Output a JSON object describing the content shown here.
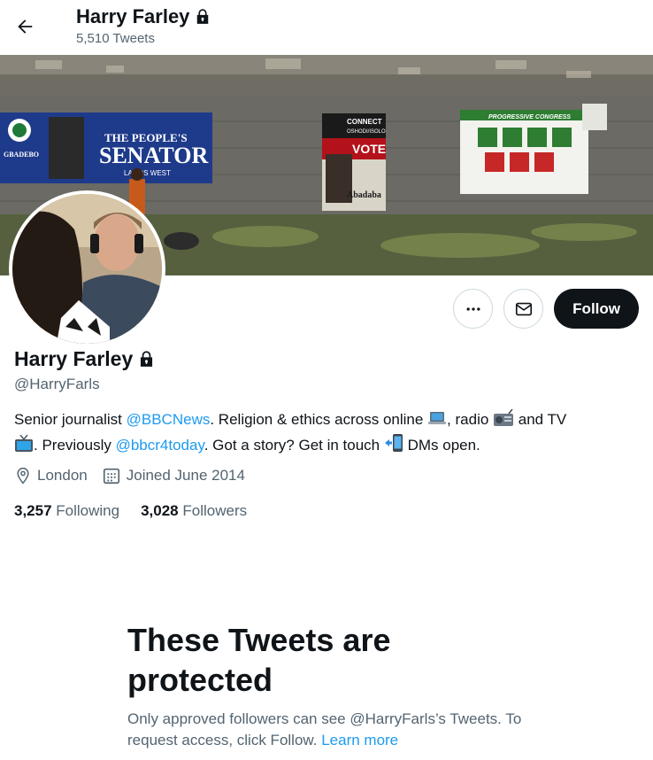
{
  "header": {
    "title": "Harry Farley",
    "tweet_count": "5,510 Tweets"
  },
  "profile": {
    "name": "Harry Farley",
    "handle": "@HarryFarls",
    "bio": {
      "part1": "Senior journalist ",
      "mention1": "@BBCNews",
      "part2": ". Religion & ethics across online ",
      "part3": ", radio ",
      "part4": " and TV",
      "part5": ". Previously ",
      "mention2": "@bbcr4today",
      "part6": ". Got a story? Get in touch ",
      "part7": " DMs open."
    },
    "location": "London",
    "joined": "Joined June 2014",
    "following_count": "3,257",
    "following_label": "Following",
    "followers_count": "3,028",
    "followers_label": "Followers"
  },
  "actions": {
    "follow_label": "Follow"
  },
  "banner": {
    "poster_left_line1": "THE PEOPLE'S",
    "poster_left_line2": "SENATOR",
    "poster_left_line3": "LAGOS WEST",
    "poster_left_name": "GBADEBO",
    "poster_mid_line1": "CONNECT",
    "poster_mid_line2": "OSHODI/ISOLO",
    "poster_mid_vote": "VOTE",
    "poster_mid_name": "Abadaba",
    "poster_right_title": "PROGRESSIVE CONGRESS"
  },
  "protected": {
    "title": "These Tweets are protected",
    "body": "Only approved followers can see @HarryFarls’s Tweets. To request access, click Follow.",
    "learn_more": "Learn more"
  },
  "colors": {
    "accent": "#1d9bf0",
    "text_primary": "#0f1419",
    "text_secondary": "#536471",
    "follow_bg": "#0f1419"
  }
}
